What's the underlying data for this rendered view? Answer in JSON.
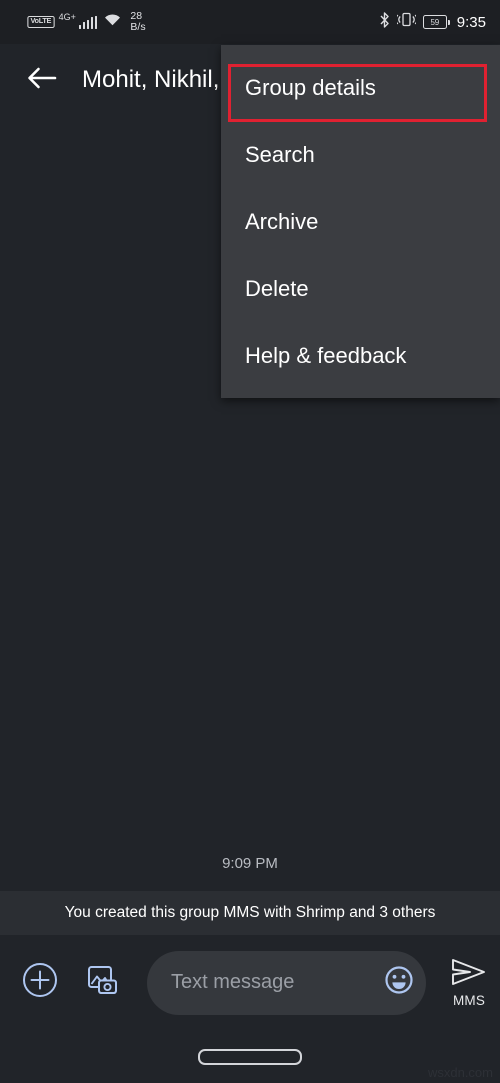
{
  "status_bar": {
    "volte_label": "VoLTE",
    "network_type": "4G+",
    "signal_icon": "signal-bars-icon",
    "wifi_icon": "wifi-icon",
    "data_speed_value": "28",
    "data_speed_unit": "B/s",
    "bluetooth_icon": "bluetooth-icon",
    "vibrate_icon": "vibrate-icon",
    "battery_level": "59",
    "clock": "9:35"
  },
  "header": {
    "back_icon": "back-arrow-icon",
    "title": "Mohit, Nikhil,"
  },
  "menu": {
    "items": [
      {
        "label": "Group details",
        "highlighted": true
      },
      {
        "label": "Search",
        "highlighted": false
      },
      {
        "label": "Archive",
        "highlighted": false
      },
      {
        "label": "Delete",
        "highlighted": false
      },
      {
        "label": "Help & feedback",
        "highlighted": false
      }
    ],
    "highlight_color": "#e02131"
  },
  "chat": {
    "timestamp": "9:09 PM",
    "system_message": "You created this group MMS with Shrimp  and 3 others"
  },
  "compose": {
    "attach_icon": "plus-circle-icon",
    "gallery_icon": "gallery-camera-icon",
    "placeholder": "Text message",
    "emoji_icon": "emoji-smiley-icon",
    "send_icon": "send-plane-icon",
    "send_label": "MMS"
  },
  "nav_bar": {
    "home_indicator": "home-indicator-pill"
  },
  "watermark": "wsxdn.com",
  "colors": {
    "app_background": "#212429",
    "menu_background": "#3b3d41",
    "banner_background": "#2b2e33",
    "accent_blue": "#aec6f0",
    "highlight_red": "#e02131"
  }
}
